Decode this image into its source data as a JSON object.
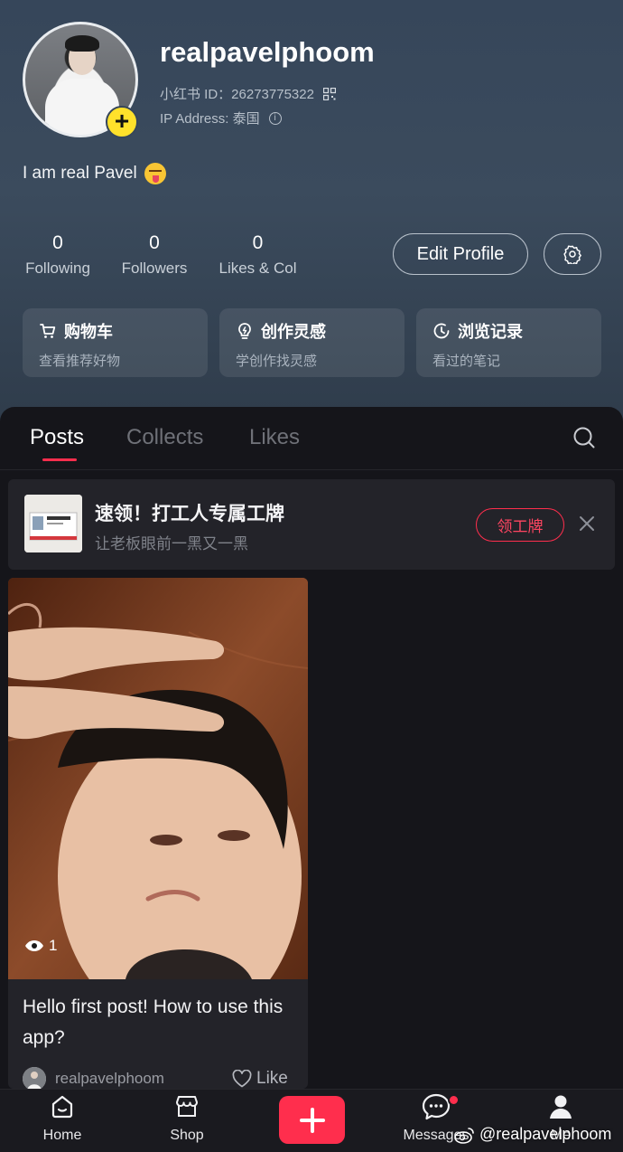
{
  "profile": {
    "username": "realpavelphoom",
    "id_label": "小红书 ID：26273775322",
    "ip_label": "IP Address: 泰国",
    "bio": "I am real Pavel"
  },
  "stats": [
    {
      "value": "0",
      "label": "Following"
    },
    {
      "value": "0",
      "label": "Followers"
    },
    {
      "value": "0",
      "label": "Likes & Col"
    }
  ],
  "actions": {
    "edit_profile": "Edit Profile",
    "settings_icon": "gear-icon"
  },
  "quick_cards": [
    {
      "title": "购物车",
      "sub": "查看推荐好物",
      "icon": "cart-icon"
    },
    {
      "title": "创作灵感",
      "sub": "学创作找灵感",
      "icon": "lightbulb-icon"
    },
    {
      "title": "浏览记录",
      "sub": "看过的笔记",
      "icon": "clock-icon"
    }
  ],
  "tabs": [
    {
      "label": "Posts",
      "active": true
    },
    {
      "label": "Collects",
      "active": false
    },
    {
      "label": "Likes",
      "active": false
    }
  ],
  "promo": {
    "title": "速领！打工人专属工牌",
    "subtitle": "让老板眼前一黑又一黑",
    "button": "领工牌"
  },
  "post": {
    "views": "1",
    "caption": "Hello first post! How to use this app?",
    "author": "realpavelphoom",
    "like_label": "Like"
  },
  "nav": [
    {
      "label": "Home",
      "icon": "home-icon"
    },
    {
      "label": "Shop",
      "icon": "shop-icon"
    },
    {
      "label": "",
      "icon": "plus-icon"
    },
    {
      "label": "Messages",
      "icon": "message-icon"
    },
    {
      "label": "Me",
      "icon": "person-icon"
    }
  ],
  "watermark": "@realpavelphoom",
  "colors": {
    "accent": "#ff2e4d",
    "badge": "#ffe12b",
    "header_bg": "#36465a",
    "panel_bg": "#15151a"
  }
}
